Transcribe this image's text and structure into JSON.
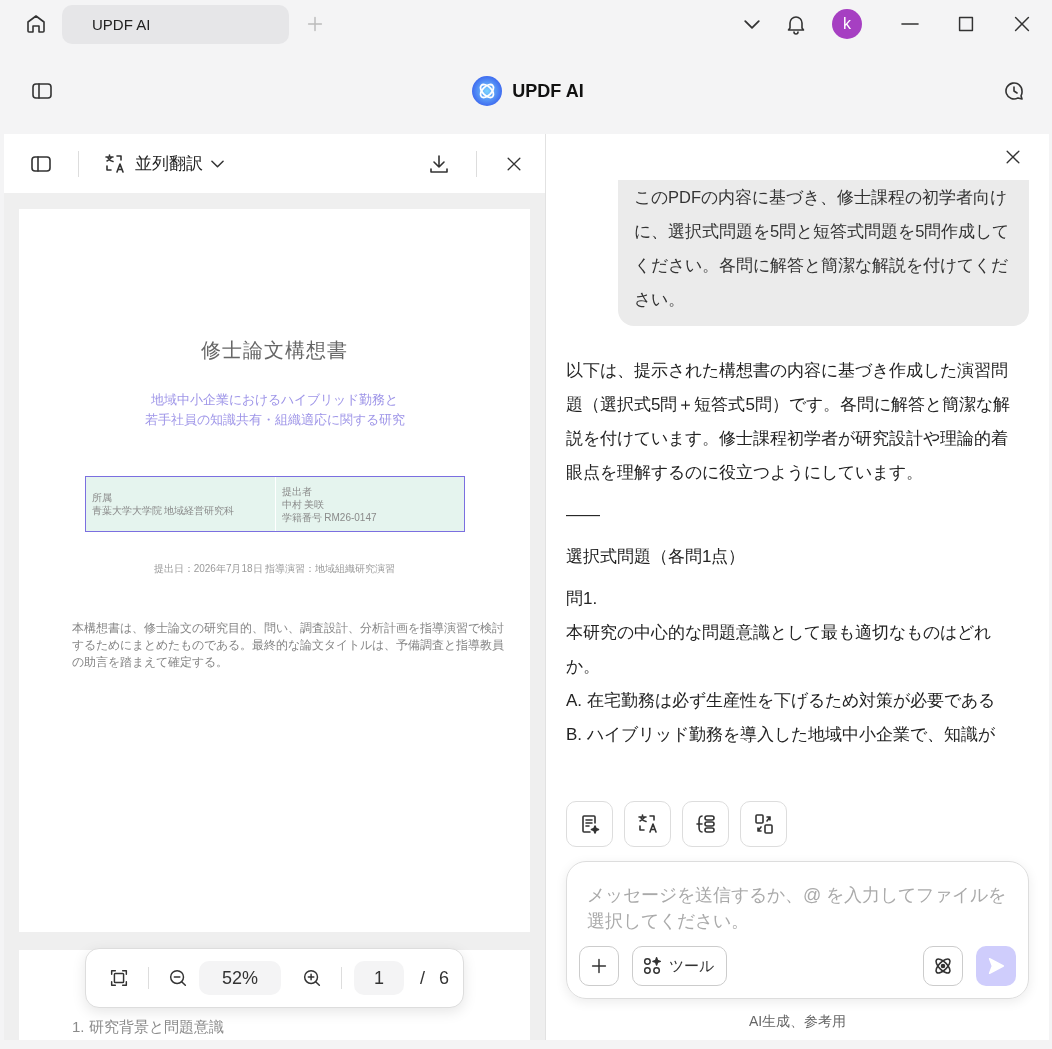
{
  "tabs": [
    {
      "label": "UPDF AI",
      "selected": true
    }
  ],
  "user": {
    "avatar_letter": "k"
  },
  "header": {
    "title": "UPDF AI"
  },
  "pdf_pane": {
    "mode_label": "並列翻訳",
    "page": {
      "title": "修士論文構想書",
      "subtitle_lines": [
        "地域中小企業におけるハイブリッド勤務と",
        "若手社員の知識共有・組織適応に関する研究"
      ],
      "info_left": [
        "所属",
        "青葉大学大学院 地域経営研究科"
      ],
      "info_right": [
        "提出者",
        "中村 美咲",
        "学籍番号 RM26-0147"
      ],
      "date_line": "提出日：2026年7月18日 指導演習：地域組織研究演習",
      "note": "本構想書は、修士論文の研究目的、問い、調査設計、分析計画を指導演習で検討するためにまとめたものである。最終的な論文タイトルは、予備調査と指導教員の助言を踏まえて確定する。"
    },
    "next_page_heading": "1. 研究背景と問題意識",
    "zoom": "52%",
    "page_number": "1",
    "page_separator": "/",
    "page_total": "6"
  },
  "chat": {
    "messages": [
      {
        "kind": "user",
        "text": "このPDFの内容に基づき、修士課程の初学者向けに、選択式問題を5問と短答式問題を5問作成してください。各問に解答と簡潔な解説を付けてください。"
      },
      {
        "kind": "assistant",
        "paragraphs": [
          "以下は、提示された構想書の内容に基づき作成した演習問題（選択式5問＋短答式5問）です。各問に解答と簡潔な解説を付けています。修士課程初学者が研究設計や理論的着眼点を理解するのに役立つようにしています。",
          "——",
          "選択式問題（各問1点）"
        ],
        "lines": [
          "問1.",
          "本研究の中心的な問題意識として最も適切なものはどれか。",
          "A. 在宅勤務は必ず生産性を下げるため対策が必要である",
          "B. ハイブリッド勤務を導入した地域中小企業で、知識が"
        ]
      }
    ],
    "input": {
      "placeholder": "メッセージを送信するか、@ を入力してファイルを選択してください。"
    },
    "tool_label": "ツール",
    "send_enabled": false,
    "footer": "AI生成、参考用"
  }
}
